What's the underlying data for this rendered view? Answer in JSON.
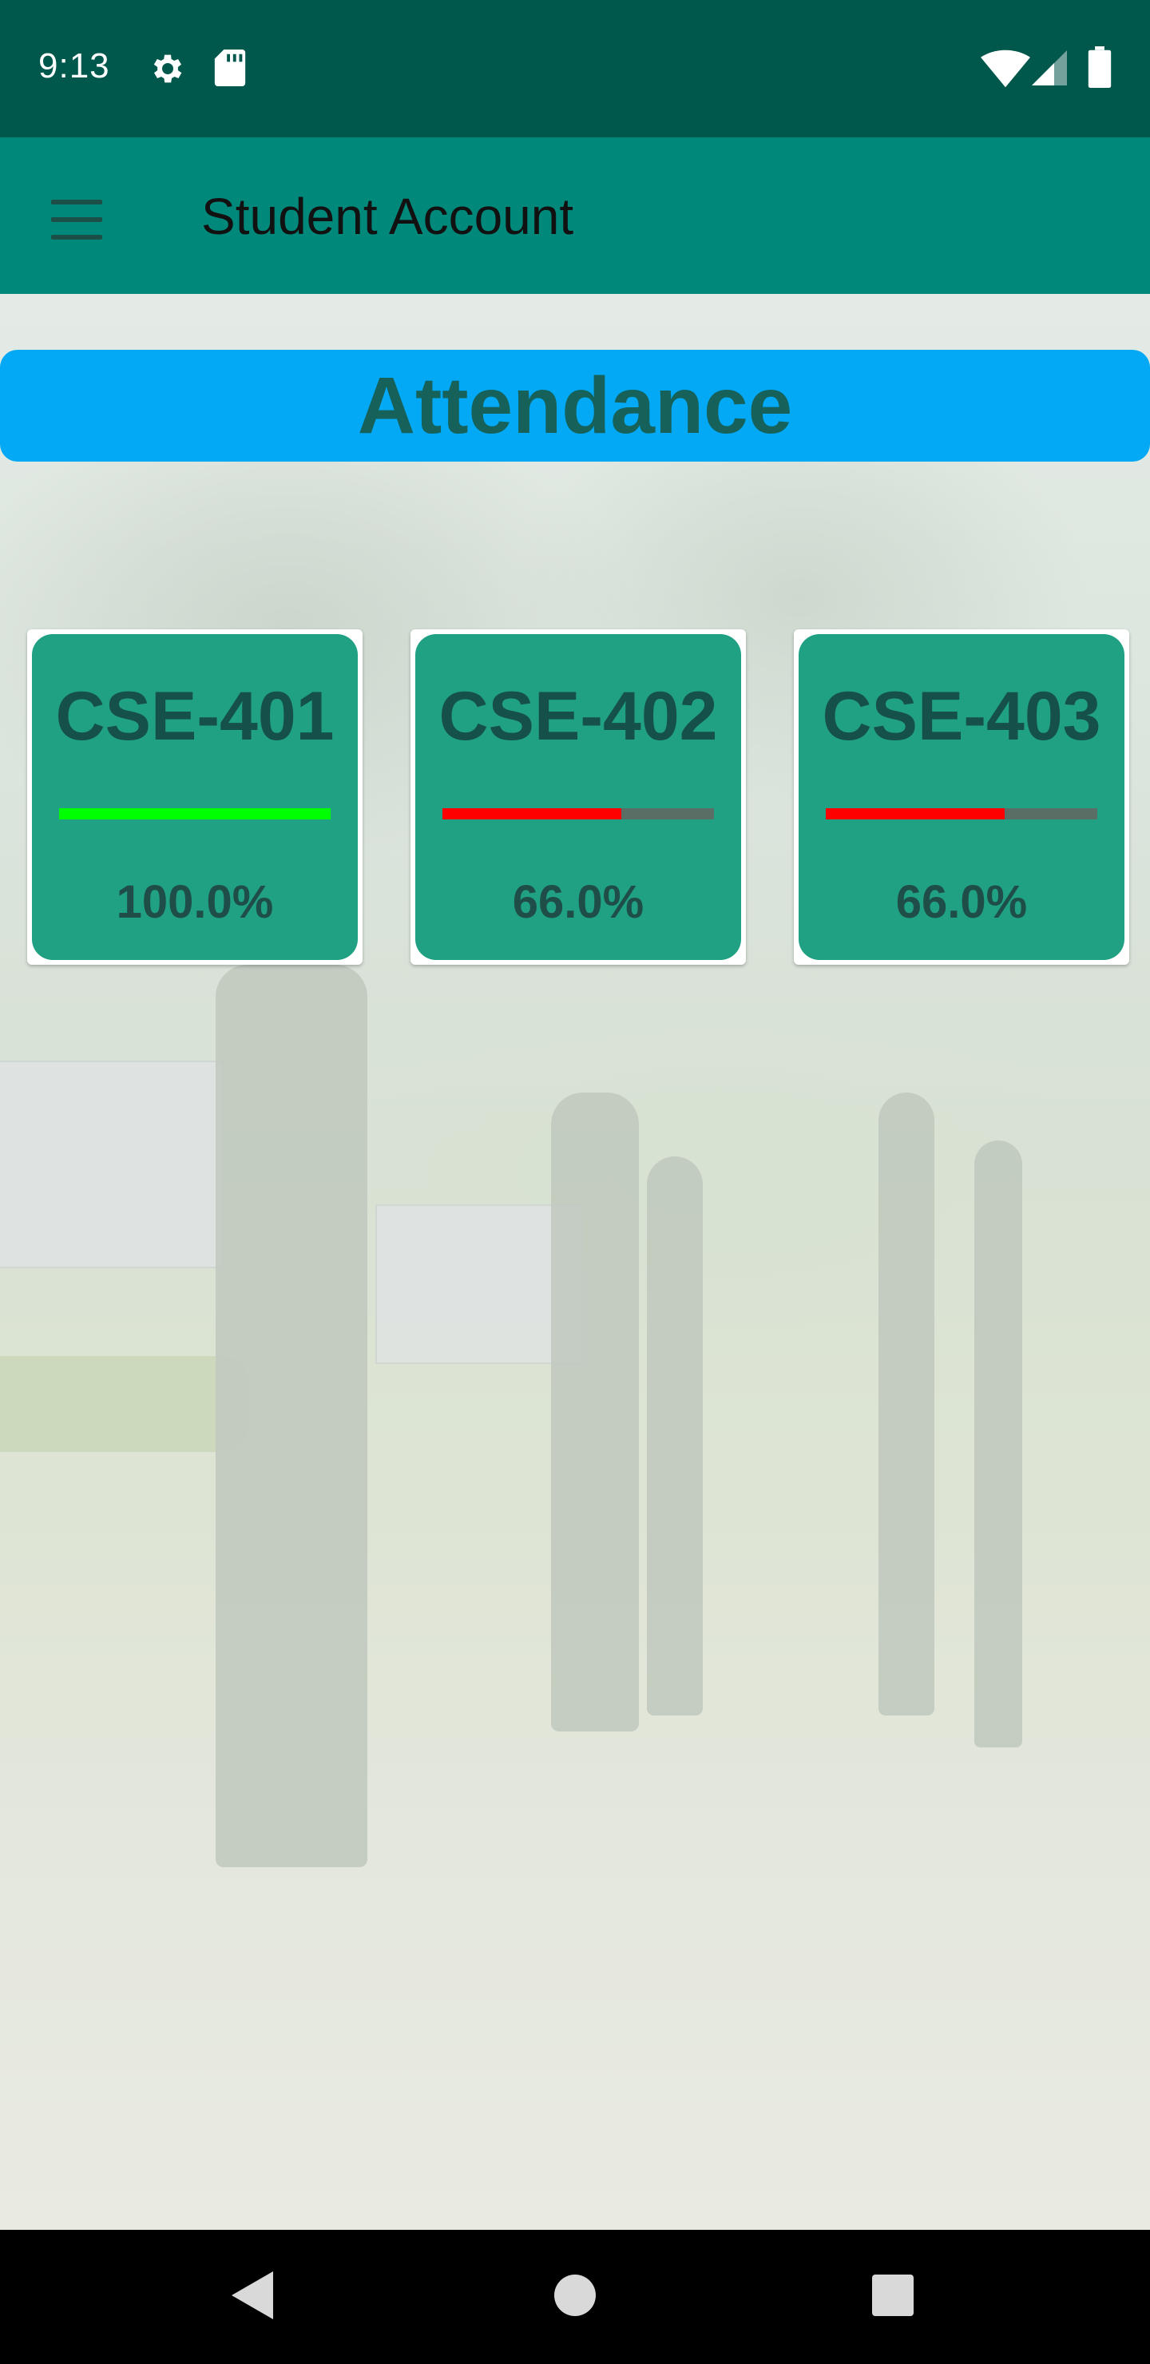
{
  "status_bar": {
    "time": "9:13",
    "icons": [
      "gear-icon",
      "sd-card-icon",
      "wifi-icon",
      "signal-icon",
      "battery-icon"
    ]
  },
  "app_bar": {
    "title": "Student Account",
    "menu_icon": "hamburger-menu-icon"
  },
  "attendance": {
    "title": "Attendance",
    "courses": [
      {
        "code": "CSE-401",
        "percent_label": "100.0%",
        "percent": 100.0,
        "bar_color": "#00ff00"
      },
      {
        "code": "CSE-402",
        "percent_label": "66.0%",
        "percent": 66.0,
        "bar_color": "#ff0000"
      },
      {
        "code": "CSE-403",
        "percent_label": "66.0%",
        "percent": 66.0,
        "bar_color": "#ff0000"
      }
    ]
  },
  "colors": {
    "status_bar": "#00574b",
    "app_bar": "#00897b",
    "banner": "#03a9f4",
    "card": "#20a184"
  },
  "nav_bar": {
    "buttons": [
      "back-icon",
      "home-icon",
      "recent-apps-icon"
    ]
  }
}
